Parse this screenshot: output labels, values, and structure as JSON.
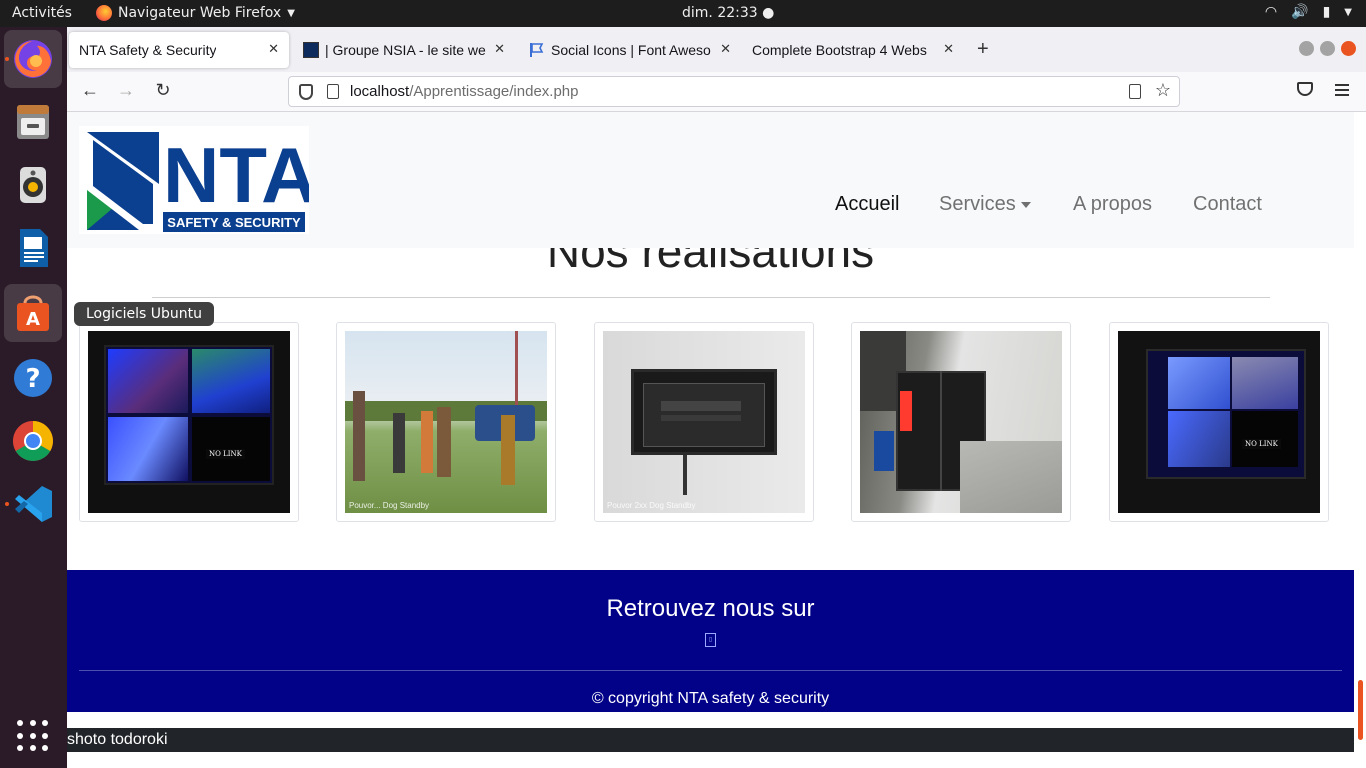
{
  "system": {
    "activities": "Activités",
    "app_menu": "Navigateur Web Firefox",
    "clock": "dim. 22:33",
    "dock_tooltip": "Logiciels Ubuntu",
    "dock_items": [
      "firefox",
      "files",
      "rhythmbox",
      "libreoffice-writer",
      "ubuntu-software",
      "help",
      "chrome",
      "vscode"
    ]
  },
  "browser": {
    "tabs": [
      {
        "title": "NTA Safety & Security",
        "active": true
      },
      {
        "title": "| Groupe NSIA - le site we",
        "active": false
      },
      {
        "title": "Social Icons | Font Aweso",
        "active": false
      },
      {
        "title": "Complete Bootstrap 4 Webs",
        "active": false
      }
    ],
    "url_host": "localhost",
    "url_path": "/Apprentissage/index.php"
  },
  "site": {
    "logo_text": "NTA",
    "logo_subtext": "SAFETY & SECURITY",
    "nav": [
      "Accueil",
      "Services",
      "A propos",
      "Contact"
    ],
    "section_title": "Nos réalisations",
    "gallery": [
      {
        "subject": "cctv-monitor",
        "watermark": "",
        "overlay": "NO LINK"
      },
      {
        "subject": "site-visit-group",
        "watermark": "Pouvor...  Dog Standby",
        "overlay": ""
      },
      {
        "subject": "network-cabinet",
        "watermark": "Pouvor 2xx  Dog Standby",
        "overlay": ""
      },
      {
        "subject": "wall-cabinet",
        "watermark": "",
        "overlay": ""
      },
      {
        "subject": "cctv-monitor-2",
        "watermark": "",
        "overlay": "NO LINK"
      }
    ],
    "footer_title": "Retrouvez nous sur",
    "social_icon": "missing-glyph-icon",
    "copyright": "© copyright NTA safety & security",
    "bottom_strip": "shoto todoroki"
  },
  "colors": {
    "footer_bg": "#020288",
    "brand_blue": "#0b3f8f",
    "brand_green": "#1a9a4a",
    "ubuntu_orange": "#e95420"
  }
}
